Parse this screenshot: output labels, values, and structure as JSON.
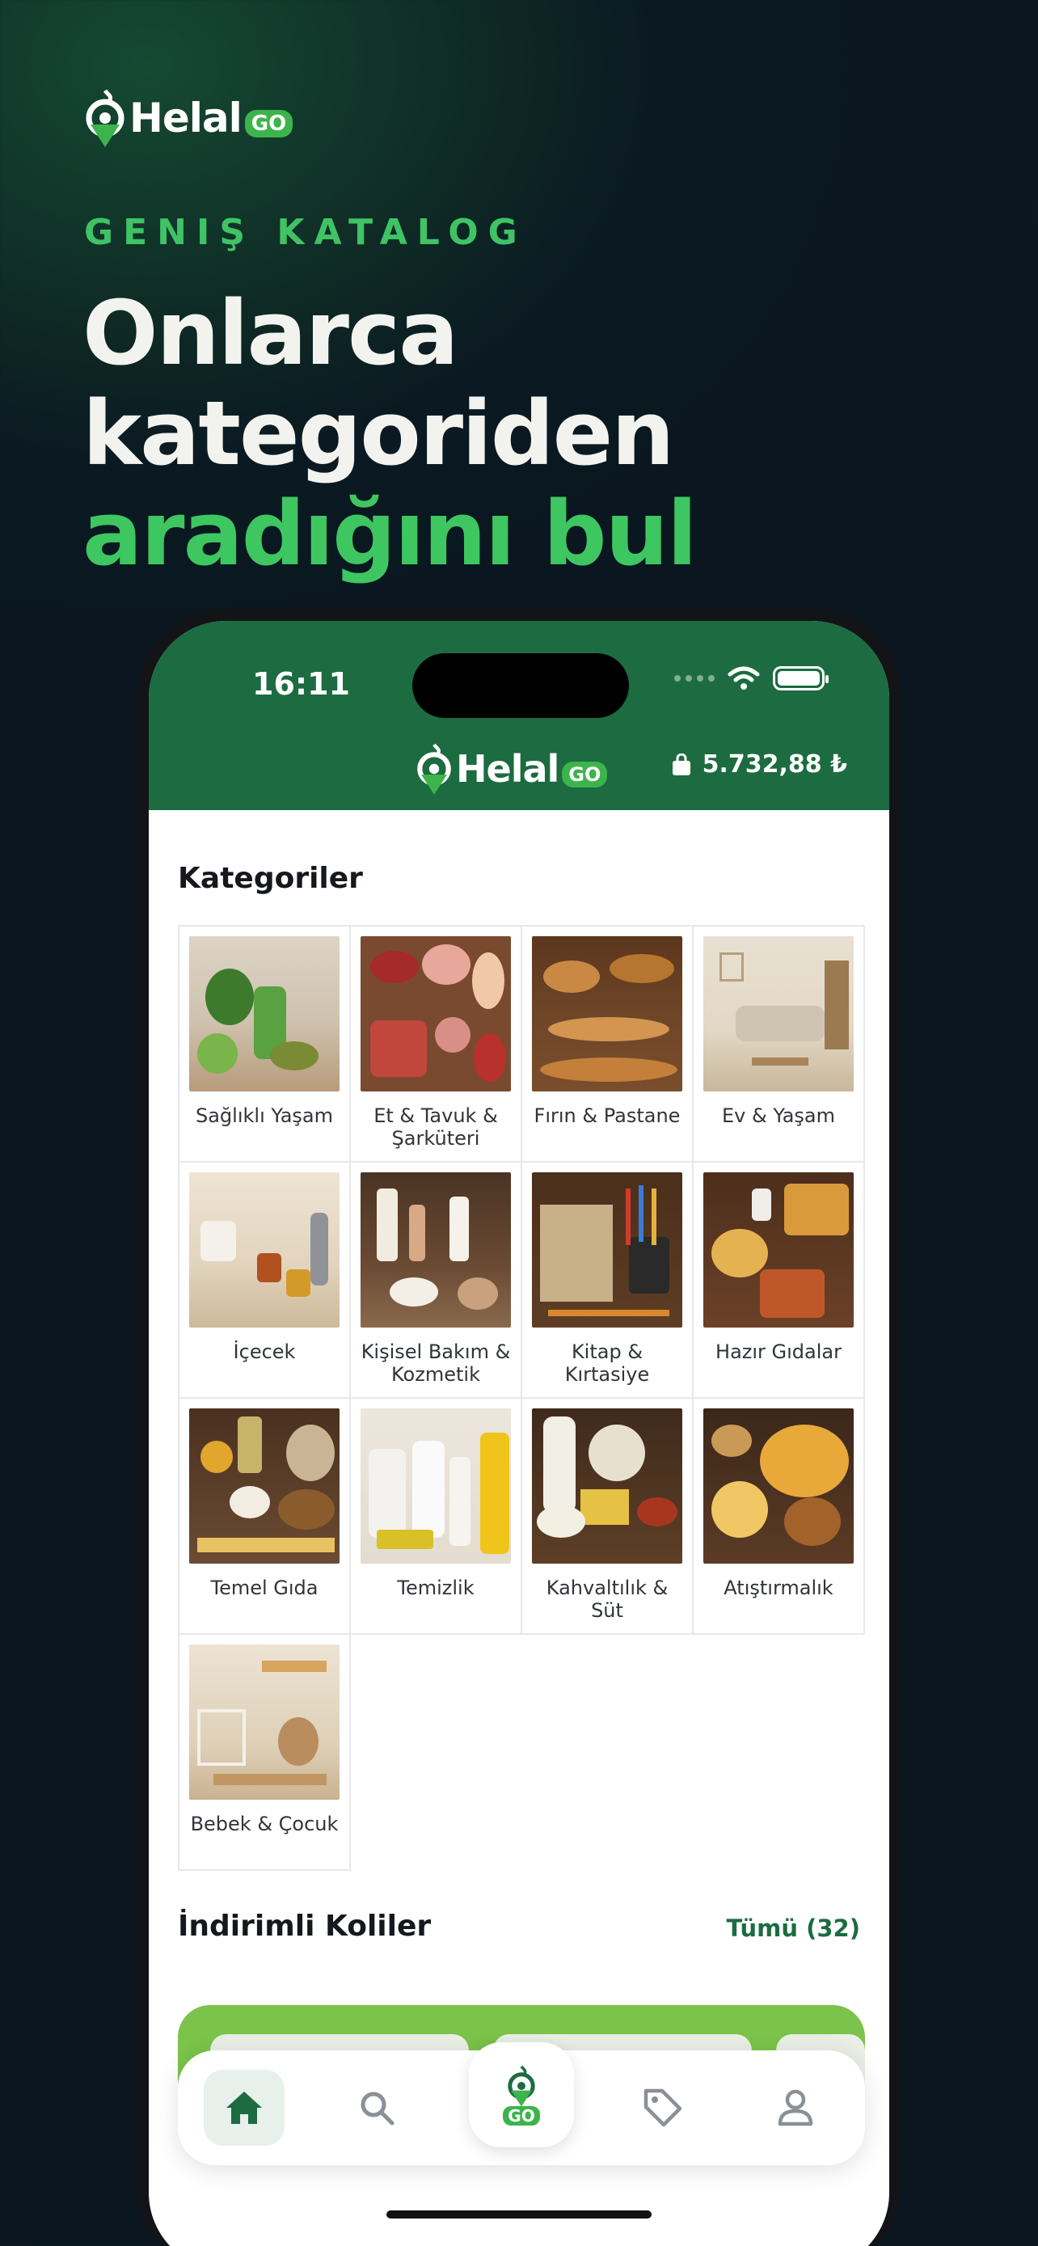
{
  "brand": {
    "word": "Helal",
    "go": "GO"
  },
  "eyebrow": "GENIŞ KATALOG",
  "headline": {
    "line1": "Onlarca",
    "line2": "kategoriden",
    "line3": "aradığını bul"
  },
  "status_bar": {
    "time": "16:11"
  },
  "header": {
    "balance": "5.732,88 ₺"
  },
  "categories_title": "Kategoriler",
  "categories": [
    {
      "label": "Sağlıklı Yaşam",
      "icon": "healthy-food-photo"
    },
    {
      "label": "Et & Tavuk &\nŞarküteri",
      "icon": "meat-photo"
    },
    {
      "label": "Fırın & Pastane",
      "icon": "bakery-photo"
    },
    {
      "label": "Ev & Yaşam",
      "icon": "living-room-photo"
    },
    {
      "label": "İçecek",
      "icon": "drinks-photo"
    },
    {
      "label": "Kişisel Bakım &\nKozmetik",
      "icon": "cosmetics-photo"
    },
    {
      "label": "Kitap &\nKırtasiye",
      "icon": "stationery-photo"
    },
    {
      "label": "Hazır Gıdalar",
      "icon": "ready-food-photo"
    },
    {
      "label": "Temel Gıda",
      "icon": "staple-food-photo"
    },
    {
      "label": "Temizlik",
      "icon": "cleaning-photo"
    },
    {
      "label": "Kahvaltılık &\nSüt",
      "icon": "dairy-photo"
    },
    {
      "label": "Atıştırmalık",
      "icon": "snacks-photo"
    },
    {
      "label": "Bebek & Çocuk",
      "icon": "baby-room-photo"
    }
  ],
  "discount": {
    "title": "İndirimli Koliler",
    "see_all": "Tümü (32)"
  },
  "tabbar": {
    "items": [
      "home-icon",
      "search-icon",
      "helalgo-logo-icon",
      "tag-icon",
      "user-icon"
    ],
    "center_label": "GO"
  },
  "colors": {
    "brand_green": "#1d6b41",
    "accent_green": "#3ec661"
  }
}
